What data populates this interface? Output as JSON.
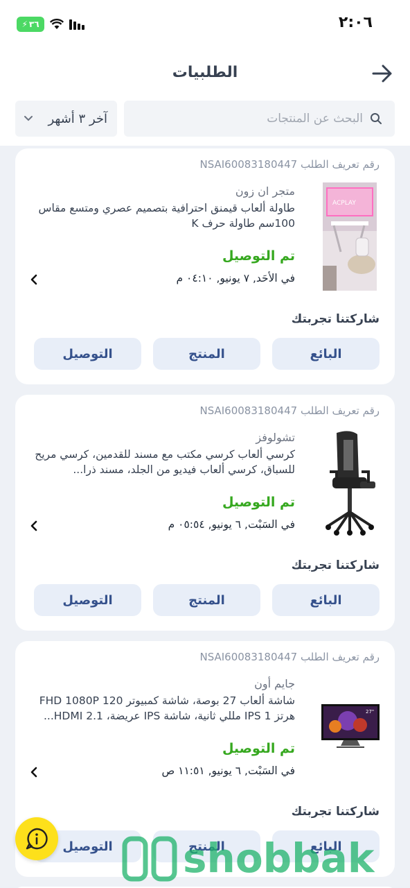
{
  "status_bar": {
    "time": "٢:٠٦",
    "battery": "٣٦",
    "icons": [
      "battery-charging-icon",
      "wifi-icon",
      "signal-bars-icon"
    ]
  },
  "header": {
    "title": "الطلبيات",
    "back_icon": "arrow-right-icon"
  },
  "filters": {
    "search_placeholder": "البحث عن المنتجات",
    "period": "آخر ٣ أشهر"
  },
  "orders": [
    {
      "order_id_label": "رقم تعريف الطلب",
      "order_id": "NSAI60083180447",
      "seller": "متجر ان زون",
      "description": "طاولة ألعاب قيمنق احترافية بتصميم عصري ومتسع مقاس 100سم طاولة حرف K",
      "status": "تم التوصيل",
      "date": "في الأحَد, ٧ يونيو, ٠٤:١٠ م",
      "thumbnail": "gaming-desk",
      "share_label": "شاركتنا تجربتك",
      "buttons": {
        "seller": "البائع",
        "product": "المنتج",
        "delivery": "التوصيل"
      }
    },
    {
      "order_id_label": "رقم تعريف الطلب",
      "order_id": "NSAI60083180447",
      "seller": "تشولوفز",
      "description": "كرسي ألعاب كرسي مكتب مع مسند للقدمين، كرسي مريح للسباق، كرسي ألعاب فيديو من الجلد، مسند ذرا...",
      "status": "تم التوصيل",
      "date": "في السَبْت, ٦ يونيو, ٠٥:٥٤ م",
      "thumbnail": "gaming-chair",
      "share_label": "شاركتنا تجربتك",
      "buttons": {
        "seller": "البائع",
        "product": "المنتج",
        "delivery": "التوصيل"
      }
    },
    {
      "order_id_label": "رقم تعريف الطلب",
      "order_id": "NSAI60083180447",
      "seller": "جايم أون",
      "description": "شاشة ألعاب 27 بوصة، شاشة كمبيوتر FHD 1080P 120 هرتز IPS 1 مللي ثانية، شاشة IPS عريضة، HDMI 2.1...",
      "status": "تم التوصيل",
      "date": "في السَبْت, ٦ يونيو, ١١:٥١ ص",
      "thumbnail": "gaming-monitor",
      "share_label": "شاركتنا تجربتك",
      "buttons": {
        "seller": "البائع",
        "product": "المنتج",
        "delivery": "التوصيل"
      }
    }
  ],
  "help_button": "info-icon",
  "watermark": {
    "text": "shobbak",
    "color": "#1fb36b"
  },
  "colors": {
    "accent": "#35518c",
    "delivered": "#36a81f",
    "list_background": "#eef1f6",
    "fab": "#fde01b"
  }
}
